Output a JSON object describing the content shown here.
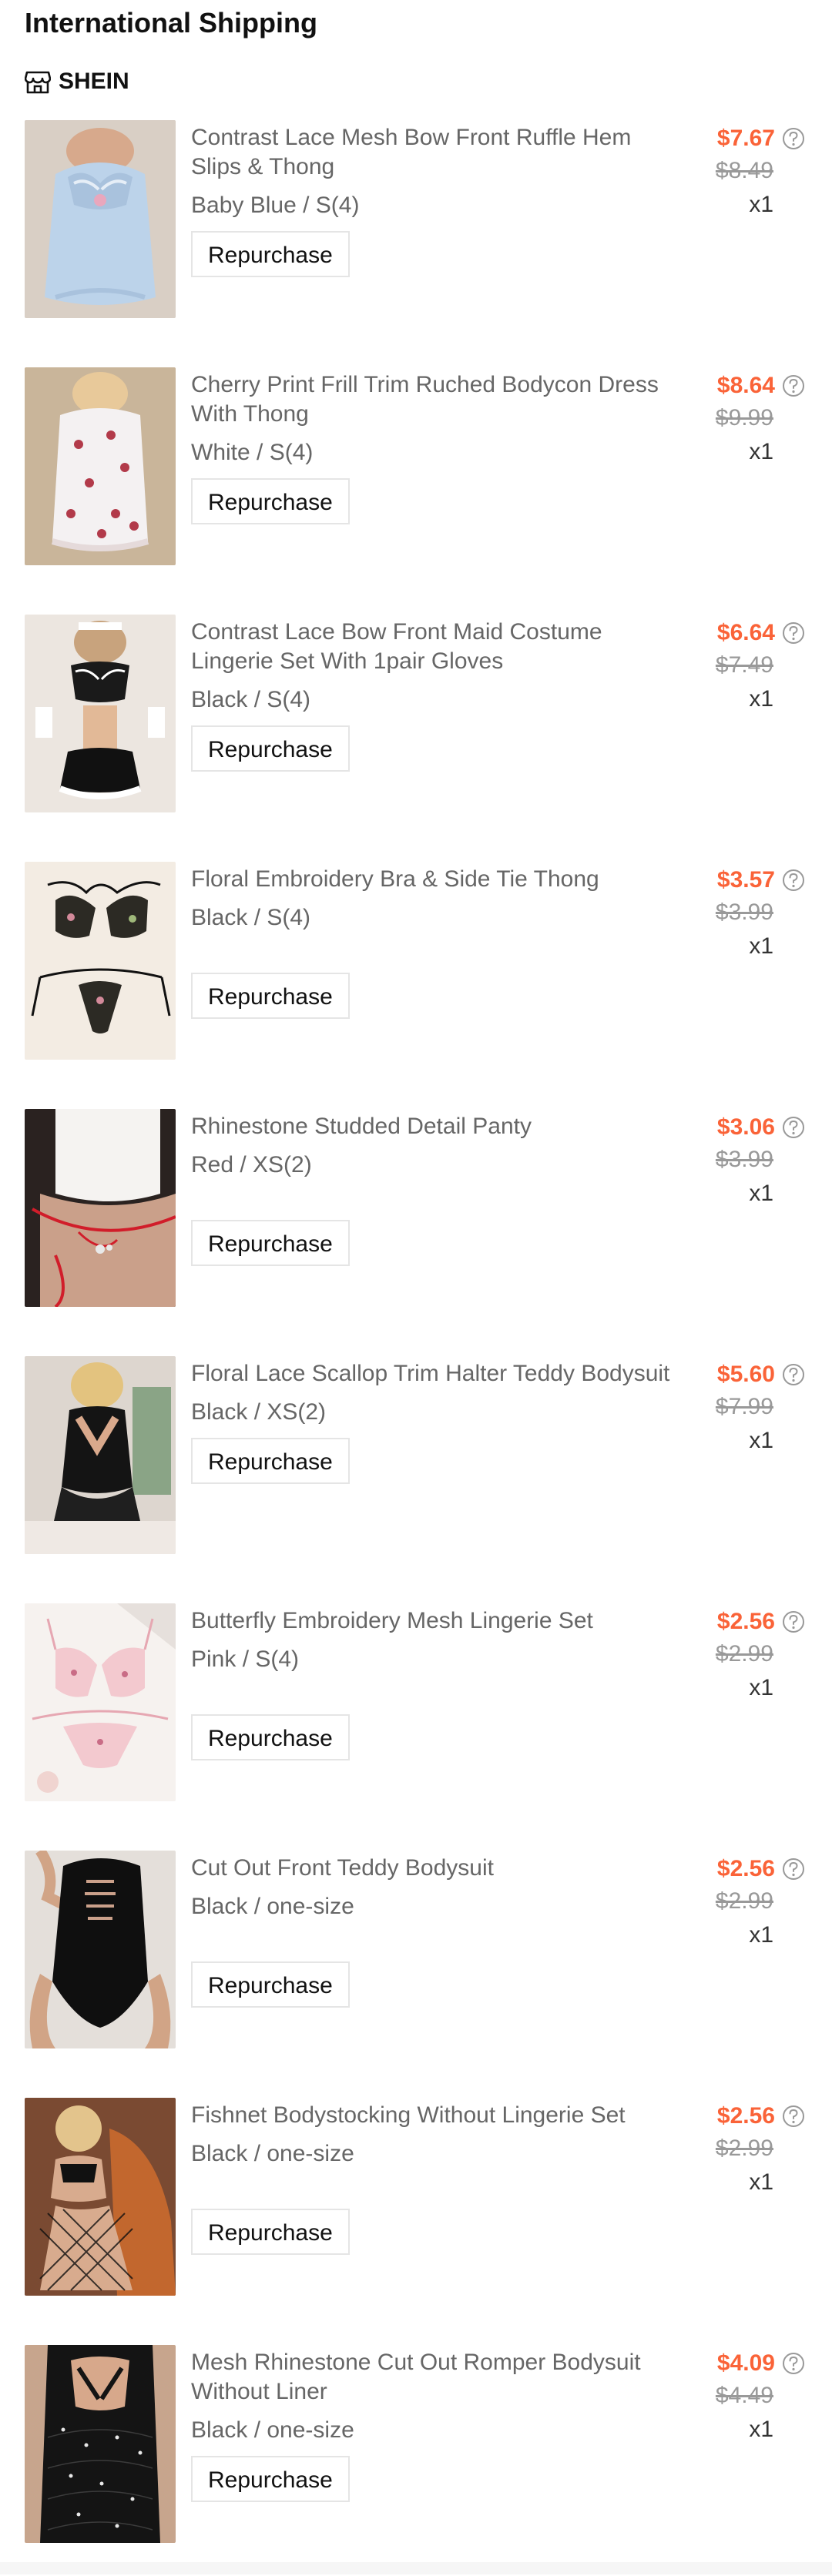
{
  "header": {
    "section_title": "International Shipping",
    "store_name": "SHEIN",
    "store_icon": "store-icon"
  },
  "labels": {
    "repurchase": "Repurchase"
  },
  "colors": {
    "sale_price": "#fa6338",
    "original_price": "#999999",
    "text_primary": "#111111",
    "text_secondary": "#666666"
  },
  "products": [
    {
      "name": "Contrast Lace Mesh Bow Front Ruffle Hem Slips & Thong",
      "variant": "Baby Blue / S(4)",
      "sale_price": "$7.67",
      "original_price": "$8.49",
      "quantity": "x1"
    },
    {
      "name": "Cherry Print Frill Trim Ruched Bodycon Dress With Thong",
      "variant": "White / S(4)",
      "sale_price": "$8.64",
      "original_price": "$9.99",
      "quantity": "x1"
    },
    {
      "name": "Contrast Lace Bow Front Maid Costume Lingerie Set With 1pair Gloves",
      "variant": "Black / S(4)",
      "sale_price": "$6.64",
      "original_price": "$7.49",
      "quantity": "x1"
    },
    {
      "name": "Floral Embroidery Bra & Side Tie Thong",
      "variant": "Black / S(4)",
      "sale_price": "$3.57",
      "original_price": "$3.99",
      "quantity": "x1"
    },
    {
      "name": "Rhinestone Studded Detail Panty",
      "variant": "Red / XS(2)",
      "sale_price": "$3.06",
      "original_price": "$3.99",
      "quantity": "x1"
    },
    {
      "name": "Floral Lace Scallop Trim Halter Teddy Bodysuit",
      "variant": "Black / XS(2)",
      "sale_price": "$5.60",
      "original_price": "$7.99",
      "quantity": "x1"
    },
    {
      "name": "Butterfly Embroidery Mesh Lingerie Set",
      "variant": "Pink / S(4)",
      "sale_price": "$2.56",
      "original_price": "$2.99",
      "quantity": "x1"
    },
    {
      "name": "Cut Out Front Teddy Bodysuit",
      "variant": "Black / one-size",
      "sale_price": "$2.56",
      "original_price": "$2.99",
      "quantity": "x1"
    },
    {
      "name": "Fishnet Bodystocking Without Lingerie Set",
      "variant": "Black / one-size",
      "sale_price": "$2.56",
      "original_price": "$2.99",
      "quantity": "x1"
    },
    {
      "name": "Mesh Rhinestone Cut Out Romper Bodysuit Without Liner",
      "variant": "Black / one-size",
      "sale_price": "$4.09",
      "original_price": "$4.49",
      "quantity": "x1"
    }
  ]
}
